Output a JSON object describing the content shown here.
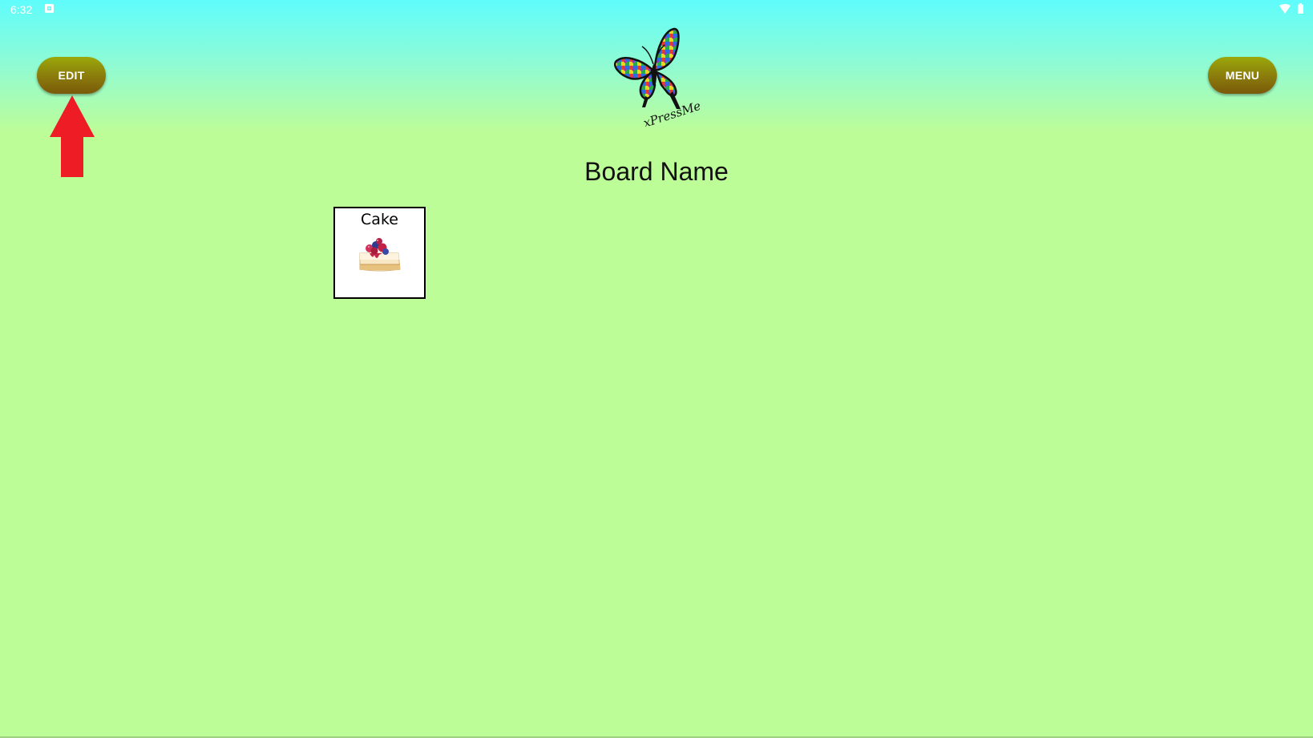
{
  "status_bar": {
    "time": "6:32",
    "icons": [
      "notification-icon",
      "wifi-icon",
      "battery-icon"
    ]
  },
  "header": {
    "edit_label": "EDIT",
    "menu_label": "MENU",
    "logo_text": "xPressMe"
  },
  "annotation": {
    "arrow_color": "#ee1c25"
  },
  "board": {
    "name": "Board Name",
    "tiles": [
      {
        "label": "Cake",
        "icon": "cake-icon"
      }
    ]
  },
  "colors": {
    "background_top": "#5ffcfc",
    "background_main": "#bdfd98",
    "button_top": "#9ba80a",
    "button_bottom": "#7a5a0a"
  }
}
